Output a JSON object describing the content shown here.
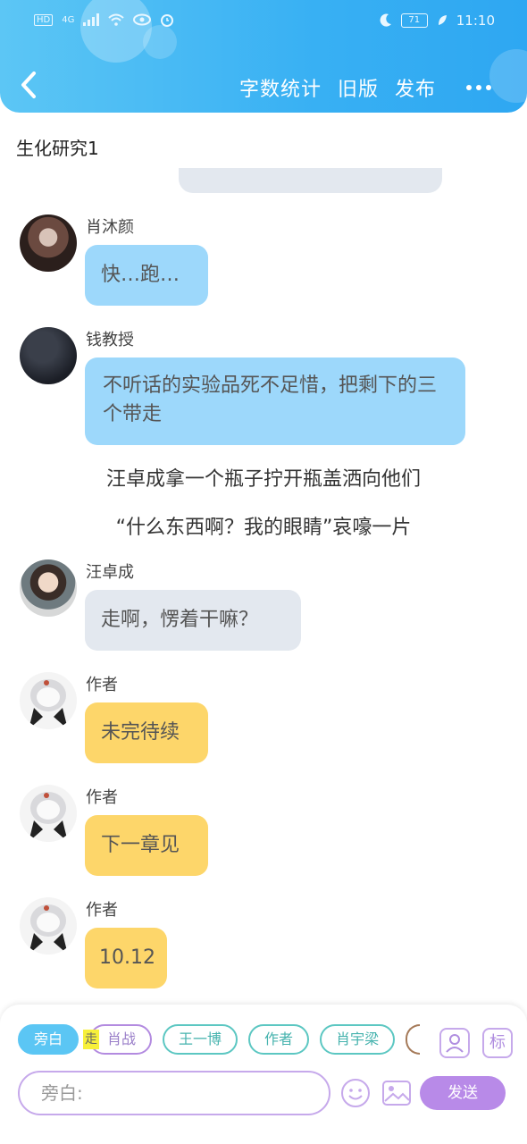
{
  "status_bar": {
    "hd": "HD",
    "network": "4G",
    "battery": "71",
    "time": "11:10"
  },
  "header": {
    "actions": [
      "字数统计",
      "旧版",
      "发布"
    ]
  },
  "chat": {
    "title": "生化研究1",
    "messages": [
      {
        "name": "肖沐颜",
        "text": "快…跑…"
      },
      {
        "name": "钱教授",
        "text": "不听话的实验品死不足惜，把剩下的三个带走"
      },
      {
        "narration": "汪卓成拿一个瓶子拧开瓶盖洒向他们"
      },
      {
        "narration": "“什么东西啊？我的眼睛”哀嚎一片"
      },
      {
        "name": "汪卓成",
        "text": "走啊，愣着干嘛？"
      },
      {
        "name": "作者",
        "text": "未完待续"
      },
      {
        "name": "作者",
        "text": "下一章见"
      },
      {
        "name": "作者",
        "text": "10.12"
      }
    ]
  },
  "bottom": {
    "chips": [
      "旁白",
      "肖战",
      "王一博",
      "作者",
      "肖宇梁"
    ],
    "highlight_char": "走",
    "tag_button": "标",
    "input_placeholder": "旁白:",
    "send_label": "发送"
  },
  "colors": {
    "header_gradient_start": "#5cc6f5",
    "header_gradient_end": "#2ea7f2",
    "bubble_blue": "#9dd8fb",
    "bubble_grey": "#e3e8ef",
    "bubble_yellow": "#fdd66a",
    "accent_purple": "#b88ae8"
  }
}
